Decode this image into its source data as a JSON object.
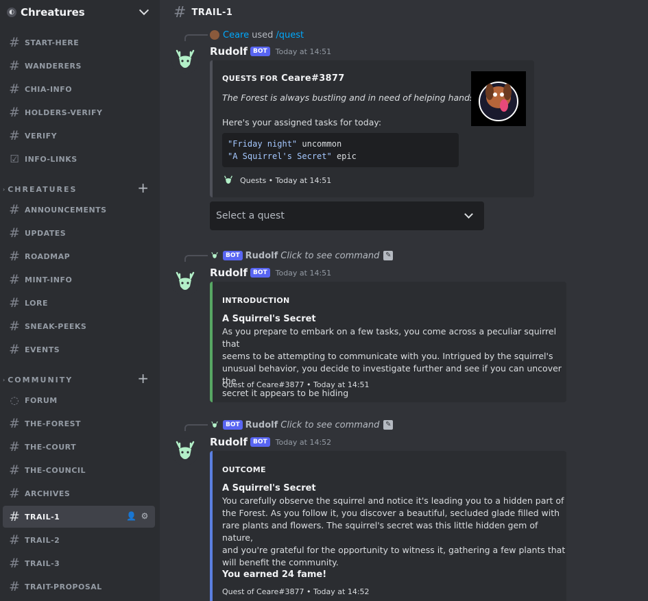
{
  "server": {
    "name": "Chreatures",
    "icon": "server-icon"
  },
  "channels_top": [
    {
      "name": "START-HERE",
      "icon": "hash-icon"
    },
    {
      "name": "WANDERERS",
      "icon": "hash-icon"
    },
    {
      "name": "CHIA-INFO",
      "icon": "hash-icon"
    },
    {
      "name": "HOLDERS-VERIFY",
      "icon": "hash-icon"
    },
    {
      "name": "VERIFY",
      "icon": "hash-icon"
    },
    {
      "name": "INFO-LINKS",
      "icon": "checkbox-icon"
    }
  ],
  "category_1": {
    "name": "CHREATURES"
  },
  "channels_chreatures": [
    {
      "name": "ANNOUNCEMENTS",
      "icon": "hash-icon"
    },
    {
      "name": "UPDATES",
      "icon": "hash-icon"
    },
    {
      "name": "ROADMAP",
      "icon": "hash-icon"
    },
    {
      "name": "MINT-INFO",
      "icon": "hash-icon"
    },
    {
      "name": "LORE",
      "icon": "hash-icon"
    },
    {
      "name": "SNEAK-PEEKS",
      "icon": "hash-icon"
    },
    {
      "name": "EVENTS",
      "icon": "hash-icon"
    }
  ],
  "category_2": {
    "name": "COMMUNITY"
  },
  "channels_community": [
    {
      "name": "FORUM",
      "icon": "forum-icon"
    },
    {
      "name": "THE-FOREST",
      "icon": "hash-icon"
    },
    {
      "name": "THE-COURT",
      "icon": "hash-icon"
    },
    {
      "name": "THE-COUNCIL",
      "icon": "hash-icon"
    },
    {
      "name": "ARCHIVES",
      "icon": "hash-icon"
    },
    {
      "name": "TRAIL-1",
      "icon": "hash-icon",
      "active": true
    },
    {
      "name": "TRAIL-2",
      "icon": "hash-icon"
    },
    {
      "name": "TRAIL-3",
      "icon": "hash-icon"
    },
    {
      "name": "TRAIT-PROPOSAL",
      "icon": "hash-icon"
    }
  ],
  "header": {
    "channel": "TRAIL-1"
  },
  "messages": [
    {
      "reply": {
        "user": "Ceare",
        "used": "used",
        "command": "/quest"
      },
      "author": "Rudolf",
      "bot_tag": "BOT",
      "time": "Today at 14:51",
      "embed": {
        "title_prefix": "QUESTS FOR",
        "title_user": "Ceare#3877",
        "italic": "The Forest is always bustling and in need of helping hands.",
        "text": "Here's your assigned tasks for today:",
        "code": [
          {
            "str": "\"Friday night\"",
            "rest": " uncommon"
          },
          {
            "str": "\"A Squirrel's Secret\"",
            "rest": " epic"
          }
        ],
        "footer": "Quests • Today at 14:51"
      },
      "select_placeholder": "Select a quest"
    },
    {
      "reply": {
        "bot_tag": "BOT",
        "user": "Rudolf",
        "hint": "Click to see command"
      },
      "author": "Rudolf",
      "bot_tag": "BOT",
      "time": "Today at 14:51",
      "embed": {
        "title": "INTRODUCTION",
        "subtitle": "A Squirrel's Secret",
        "lines": [
          "As you prepare to embark on a few tasks, you come across a peculiar squirrel that",
          "seems to be attempting to communicate with you. Intrigued by the squirrel's",
          "unusual behavior, you decide to investigate further and see if you can uncover the",
          "secret it appears to be hiding"
        ],
        "footer": "Quest of Ceare#3877 • Today at 14:51",
        "color": "#57a663"
      }
    },
    {
      "reply": {
        "bot_tag": "BOT",
        "user": "Rudolf",
        "hint": "Click to see command"
      },
      "author": "Rudolf",
      "bot_tag": "BOT",
      "time": "Today at 14:52",
      "embed": {
        "title": "OUTCOME",
        "subtitle": "A Squirrel's Secret",
        "lines": [
          "You carefully observe the squirrel and notice it's leading you to a hidden part of",
          "the Forest. As you follow it, you discover a beautiful, secluded glade filled with",
          "rare plants and flowers. The squirrel's secret was this little hidden gem of nature,",
          "and you're grateful for the opportunity to witness it, gathering a few plants that",
          "will benefit the community."
        ],
        "fame": "You earned 24 fame!",
        "footer": "Quest of Ceare#3877 • Today at 14:52",
        "color": "#5b7fe0"
      }
    }
  ],
  "colors": {
    "bot_tag": "#5865f2",
    "link": "#00a8fc",
    "sidebar": "#2b2d31",
    "main": "#313338"
  }
}
